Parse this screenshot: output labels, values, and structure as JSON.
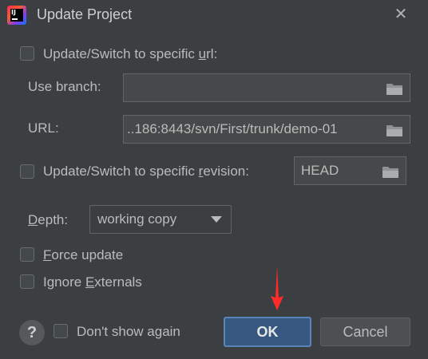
{
  "window": {
    "title": "Update Project"
  },
  "options": {
    "switch_url": {
      "label_pre": "Update/Switch to specific ",
      "mnemonic": "u",
      "label_post": "rl:",
      "checked": false
    },
    "use_branch": {
      "label": "Use branch:",
      "value": ""
    },
    "url": {
      "label": "URL:",
      "value": "..186:8443/svn/First/trunk/demo-01"
    },
    "switch_revision": {
      "label_pre": "Update/Switch to specific ",
      "mnemonic": "r",
      "label_post": "evision:",
      "checked": false,
      "value": "HEAD"
    },
    "depth": {
      "mnemonic": "D",
      "label_post": "epth:",
      "value": "working copy"
    },
    "force_update": {
      "mnemonic": "F",
      "label_post": "orce update",
      "checked": false
    },
    "ignore_externals": {
      "label_pre": "Ignore ",
      "mnemonic": "E",
      "label_post": "xternals",
      "checked": false
    }
  },
  "footer": {
    "help": "?",
    "dont_show": {
      "label": "Don't show again",
      "checked": false
    },
    "ok_label": "OK",
    "cancel_label": "Cancel"
  },
  "colors": {
    "accent": "#365880",
    "annotation_arrow": "#ff2a2a"
  },
  "icons": {
    "app": "intellij-idea-logo",
    "folder": "folder-icon",
    "close": "close-icon"
  }
}
